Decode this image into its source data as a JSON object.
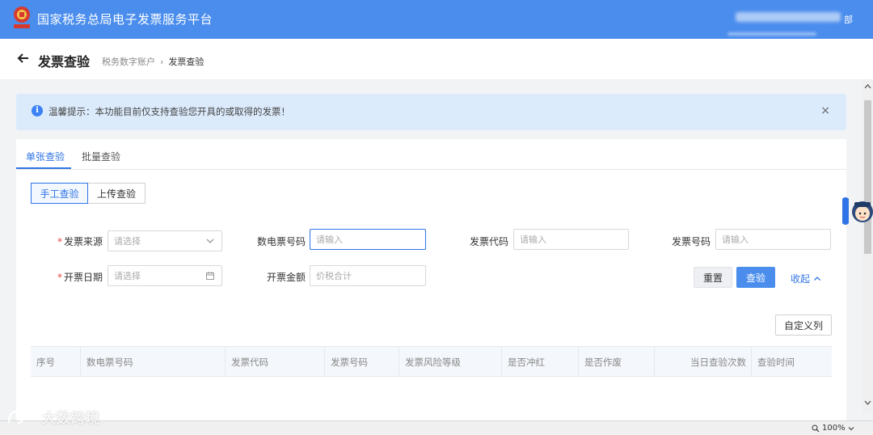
{
  "header": {
    "platform_title": "国家税务总局电子发票服务平台",
    "user_suffix": "部"
  },
  "page": {
    "title": "发票查验",
    "breadcrumb": [
      "税务数字账户",
      "发票查验"
    ]
  },
  "notice": {
    "text": "温馨提示：本功能目前仅支持查验您开具的或取得的发票！",
    "close": "×"
  },
  "tabs": [
    {
      "label": "单张查验",
      "active": true
    },
    {
      "label": "批量查验",
      "active": false
    }
  ],
  "modes": [
    {
      "label": "手工查验",
      "active": true
    },
    {
      "label": "上传查验",
      "active": false
    }
  ],
  "form": {
    "source": {
      "label": "发票来源",
      "placeholder": "请选择",
      "required": true
    },
    "einvoice_no": {
      "label": "数电票号码",
      "placeholder": "请输入"
    },
    "invoice_code": {
      "label": "发票代码",
      "placeholder": "请输入"
    },
    "invoice_no": {
      "label": "发票号码",
      "placeholder": "请输入"
    },
    "issue_date": {
      "label": "开票日期",
      "placeholder": "请选择",
      "required": true
    },
    "amount": {
      "label": "开票金额",
      "placeholder": "价税合计"
    }
  },
  "actions": {
    "reset": "重置",
    "query": "查验",
    "collapse": "收起",
    "custom_columns": "自定义列"
  },
  "table": {
    "columns": [
      "序号",
      "数电票号码",
      "发票代码",
      "发票号码",
      "发票风险等级",
      "是否冲红",
      "是否作废",
      "当日查验次数",
      "查验时间"
    ]
  },
  "statusbar": {
    "zoom": "100%"
  },
  "watermark": {
    "text": "大数跨境"
  },
  "colors": {
    "brand_blue": "#4a8ded",
    "link_blue": "#2f74e6",
    "required_red": "#e54545",
    "notice_bg": "#dcebfc"
  }
}
